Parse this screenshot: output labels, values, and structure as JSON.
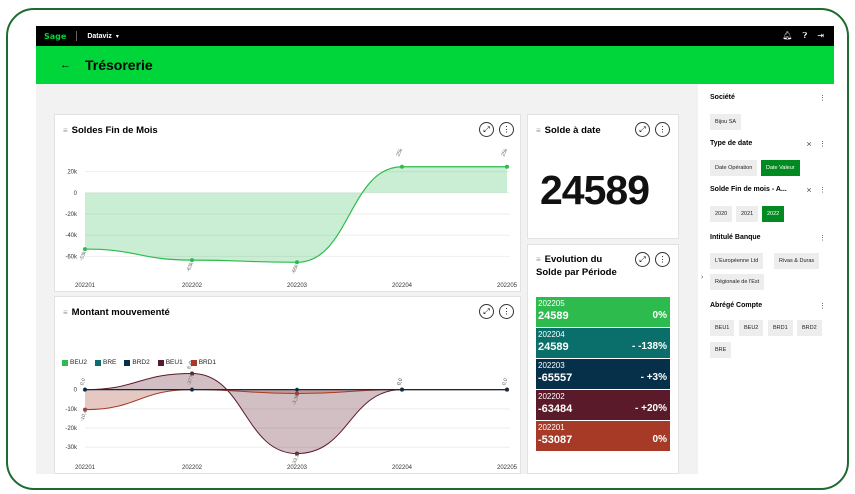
{
  "topbar": {
    "logo": "Sage",
    "app": "Dataviz"
  },
  "header": {
    "title": "Trésorerie"
  },
  "card_soldes": {
    "title": "Soldes Fin de Mois"
  },
  "card_solde_date": {
    "title": "Solde à date",
    "value": "24589"
  },
  "card_montant": {
    "title": "Montant mouvementé"
  },
  "card_evolution": {
    "title_line1": "Evolution du",
    "title_line2": "Solde par Période",
    "rows": [
      {
        "period": "202205",
        "value": "24589",
        "pct": "0%",
        "color": "#2dbb4e"
      },
      {
        "period": "202204",
        "value": "24589",
        "pct": "- -138%",
        "color": "#0a6e6a"
      },
      {
        "period": "202203",
        "value": "-65557",
        "pct": "- +3%",
        "color": "#06304a"
      },
      {
        "period": "202202",
        "value": "-63484",
        "pct": "- +20%",
        "color": "#5a1a2a"
      },
      {
        "period": "202201",
        "value": "-53087",
        "pct": "0%",
        "color": "#a63a26"
      }
    ]
  },
  "sidebar": {
    "societe": {
      "label": "Société",
      "chips": [
        "Bijou SA"
      ]
    },
    "type_date": {
      "label": "Type de date",
      "chips": [
        "Date Opération",
        "Date Valeur"
      ]
    },
    "solde_fin": {
      "label": "Solde Fin de mois - A...",
      "chips": [
        "2020",
        "2021",
        "2022"
      ]
    },
    "intitule": {
      "label": "Intitulé Banque",
      "chips": [
        "L'Européenne Ltd",
        "Rivas & Duras",
        "Régionale de l'Est"
      ]
    },
    "abrege": {
      "label": "Abrégé Compte",
      "chips": [
        "BEU1",
        "BEU2",
        "BRD1",
        "BRD2",
        "BRE"
      ]
    }
  },
  "chart_data": [
    {
      "type": "area",
      "title": "Soldes Fin de Mois",
      "categories": [
        "202201",
        "202202",
        "202203",
        "202204",
        "202205"
      ],
      "values": [
        -53087,
        -63484,
        -65557,
        24589,
        24589
      ],
      "point_labels": [
        "-53k",
        "-63k",
        "-66k",
        "25k",
        "25k"
      ],
      "yticks": [
        "20k",
        "0",
        "-20k",
        "-40k",
        "-60k"
      ],
      "ylim": [
        -70000,
        30000
      ],
      "color": "#2dbb4e"
    },
    {
      "type": "area",
      "title": "Montant mouvementé",
      "categories": [
        "202201",
        "202202",
        "202203",
        "202204",
        "202205"
      ],
      "yticks": [
        "0",
        "-10k",
        "-20k",
        "-30k"
      ],
      "ylim": [
        -33000,
        5000
      ],
      "legend": [
        "BEU2",
        "BRE",
        "BRD2",
        "BEU1",
        "BRD1"
      ],
      "legend_colors": [
        "#2dbb4e",
        "#0a6e6a",
        "#06304a",
        "#5a1a2a",
        "#a63a26"
      ],
      "series": [
        {
          "name": "BEU1",
          "values": [
            0,
            8400,
            -33300,
            0,
            0
          ],
          "labels": [
            "0,0",
            "8,4k",
            "-33,3k",
            "0,0",
            "0,0"
          ],
          "color": "#5a1a2a"
        },
        {
          "name": "BRD1",
          "values": [
            -10400,
            0,
            -2000,
            0,
            0
          ],
          "labels": [
            "-10,4k",
            "-3772",
            "-3,3k",
            "0,0",
            ""
          ],
          "color": "#a63a26"
        }
      ]
    }
  ]
}
